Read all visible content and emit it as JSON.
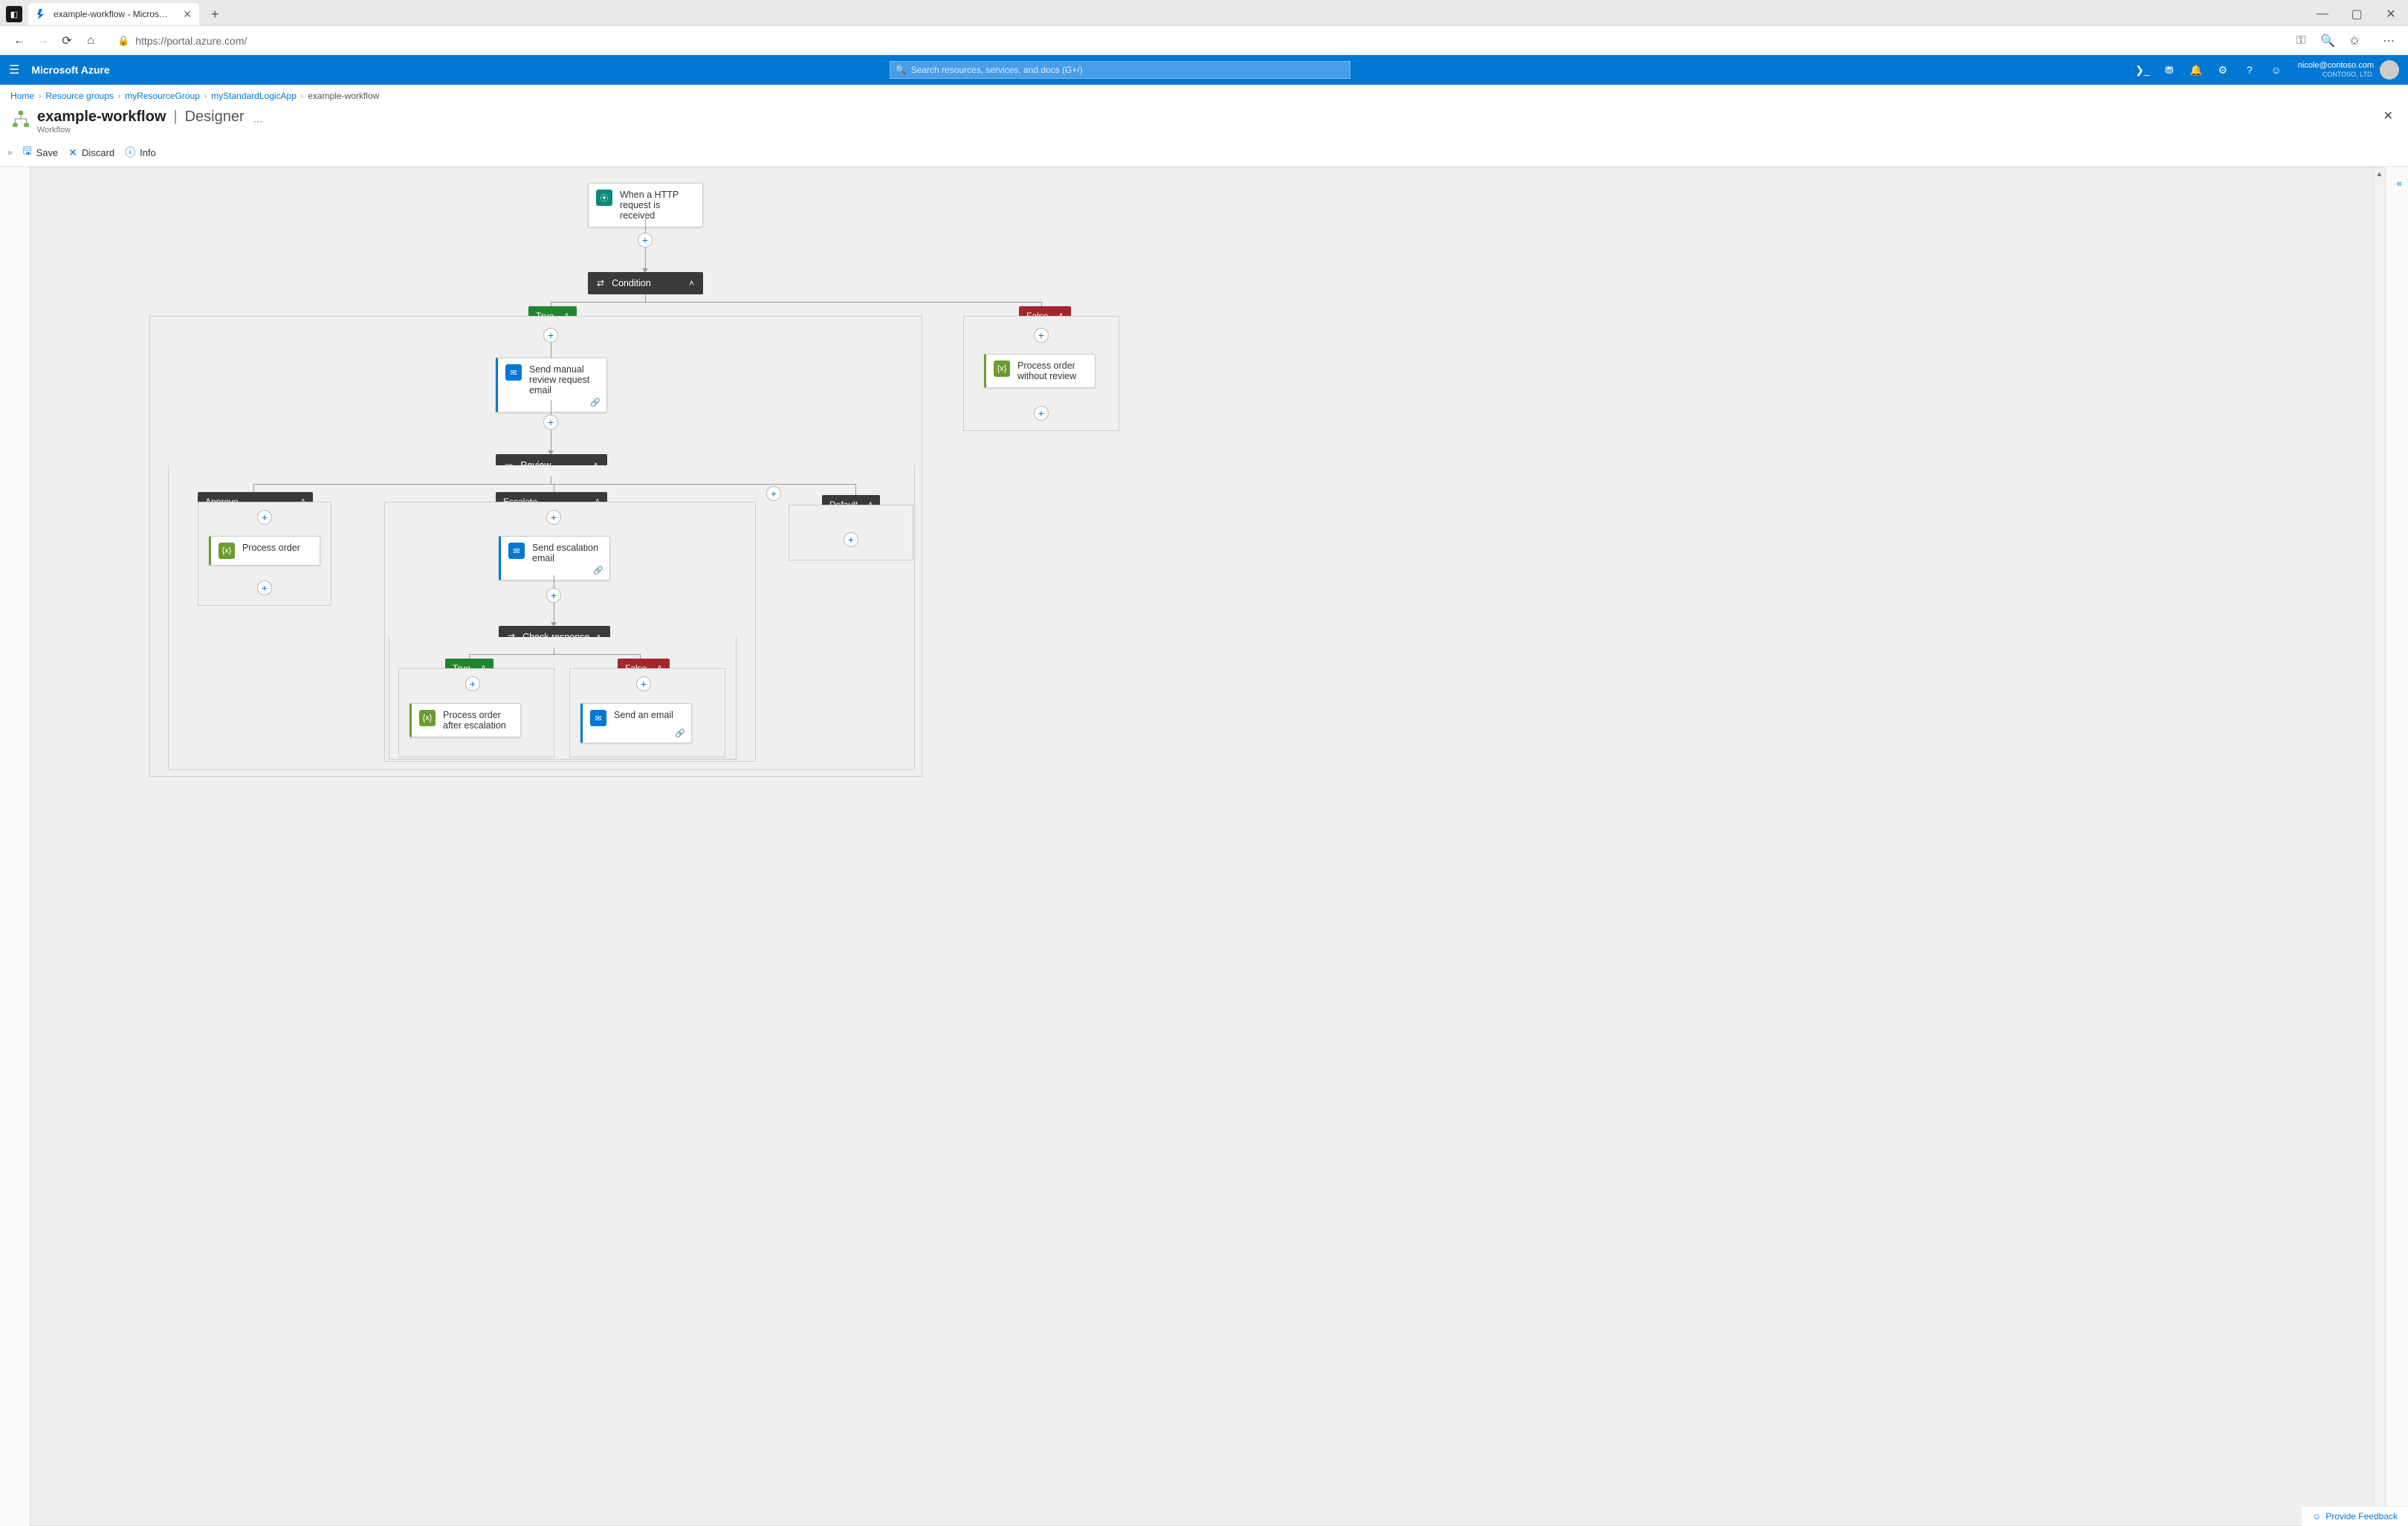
{
  "browser": {
    "tab_title": "example-workflow - Microsoft A...",
    "url": "https://portal.azure.com/"
  },
  "azure": {
    "product": "Microsoft Azure",
    "search_placeholder": "Search resources, services, and docs (G+/)",
    "user_email": "nicole@contoso.com",
    "user_org": "CONTOSO, LTD."
  },
  "breadcrumb": [
    "Home",
    "Resource groups",
    "myResourceGroup",
    "myStandardLogicApp",
    "example-workflow"
  ],
  "title": {
    "name": "example-workflow",
    "suffix": "Designer",
    "subtitle": "Workflow"
  },
  "toolbar": {
    "save": "Save",
    "discard": "Discard",
    "info": "Info"
  },
  "designer": {
    "trigger": "When a HTTP request is received",
    "condition": "Condition",
    "true_label": "True",
    "false_label": "False",
    "send_review_email": "Send manual review request email",
    "process_without_review": "Process order without review",
    "review": "Review",
    "approve": "Approve",
    "escalate": "Escalate",
    "default": "Default",
    "process_order": "Process order",
    "send_escalation_email": "Send escalation email",
    "check_response": "Check response",
    "process_after_escalation": "Process order after escalation",
    "send_an_email": "Send an email"
  },
  "footer": {
    "feedback": "Provide Feedback"
  }
}
